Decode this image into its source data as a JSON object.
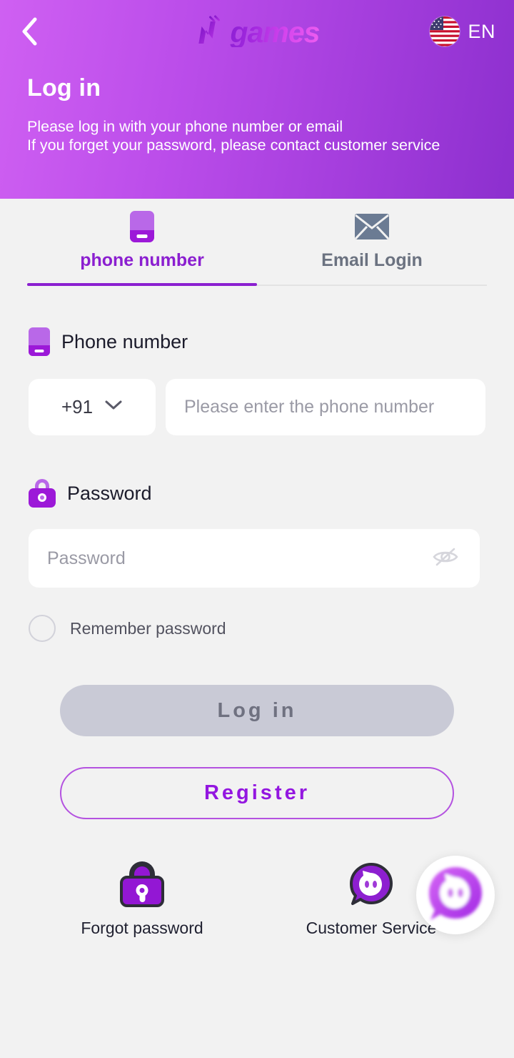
{
  "header": {
    "back_icon": "chevron-left-icon",
    "logo_mark_icon": "n-logo-mark",
    "logo_text": "games",
    "flag_icon": "us-flag-icon",
    "lang_code": "EN",
    "title": "Log in",
    "subtitle_line1": "Please log in with your phone number or email",
    "subtitle_line2": "If you forget your password, please contact customer service",
    "gradient_from": "#cf60f2",
    "gradient_to": "#8c2fce"
  },
  "tabs": [
    {
      "label": "phone number",
      "icon": "phone-icon",
      "active": true,
      "active_color": "#8b1fd0"
    },
    {
      "label": "Email Login",
      "icon": "envelope-icon",
      "active": false,
      "inactive_color": "#6b7280"
    }
  ],
  "form": {
    "phone_label": "Phone number",
    "phone_label_icon": "phone-icon",
    "country_code": "+91",
    "country_chevron_icon": "chevron-down-icon",
    "phone_placeholder": "Please enter the phone number",
    "password_label": "Password",
    "password_label_icon": "lock-icon",
    "password_placeholder": "Password",
    "password_value": "",
    "password_toggle_icon": "eye-slash-icon",
    "remember_label": "Remember password",
    "remember_checked": false
  },
  "actions": {
    "login_label": "Log in",
    "login_disabled": true,
    "login_bg": "#c9cad6",
    "login_text_color": "#6f7180",
    "register_label": "Register",
    "register_color": "#9316e0",
    "register_border": "#b452e0"
  },
  "bottom_links": [
    {
      "label": "Forgot password",
      "icon": "lock-icon"
    },
    {
      "label": "Customer Service",
      "icon": "chat-face-icon"
    }
  ],
  "floating": {
    "icon": "customer-service-chat-icon"
  },
  "theme": {
    "page_bg": "#f2f2f2",
    "accent": "#9316e0",
    "field_bg": "#ffffff",
    "placeholder": "#9a9aa5"
  }
}
